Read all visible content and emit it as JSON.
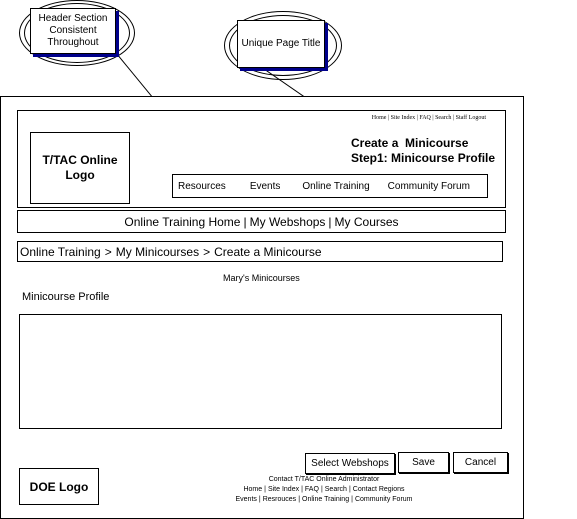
{
  "callouts": {
    "header": "Header Section Consistent Throughout",
    "title": "Unique Page Title"
  },
  "header": {
    "logo": "T/TAC Online Logo",
    "utility_links": [
      "Home",
      "Site Index",
      "FAQ",
      "Search",
      "Staff Logout"
    ],
    "title_line1": "Create a  Minicourse",
    "title_line2": "Step1: Minicourse Profile",
    "nav": [
      "Resources",
      "Events",
      "Online Training",
      "Community Forum"
    ]
  },
  "subnav": [
    "Online Training Home",
    "My Webshops",
    "My Courses"
  ],
  "breadcrumb": [
    "Online Training",
    "My Minicourses",
    "Create a Minicourse"
  ],
  "main": {
    "user_minicourses": "Mary's Minicourses",
    "section_heading": "Minicourse Profile"
  },
  "buttons": {
    "select_webshops": "Select Webshops",
    "save": "Save",
    "cancel": "Cancel"
  },
  "footer": {
    "doe_logo": "DOE Logo",
    "contact": "Contact T/TAC Online Administrator",
    "links_row1": [
      "Home",
      "Site Index",
      "FAQ",
      "Search",
      "Contact Regions"
    ],
    "links_row2": [
      "Events",
      "Resrouces",
      "Online Training",
      "Community Forum"
    ]
  }
}
